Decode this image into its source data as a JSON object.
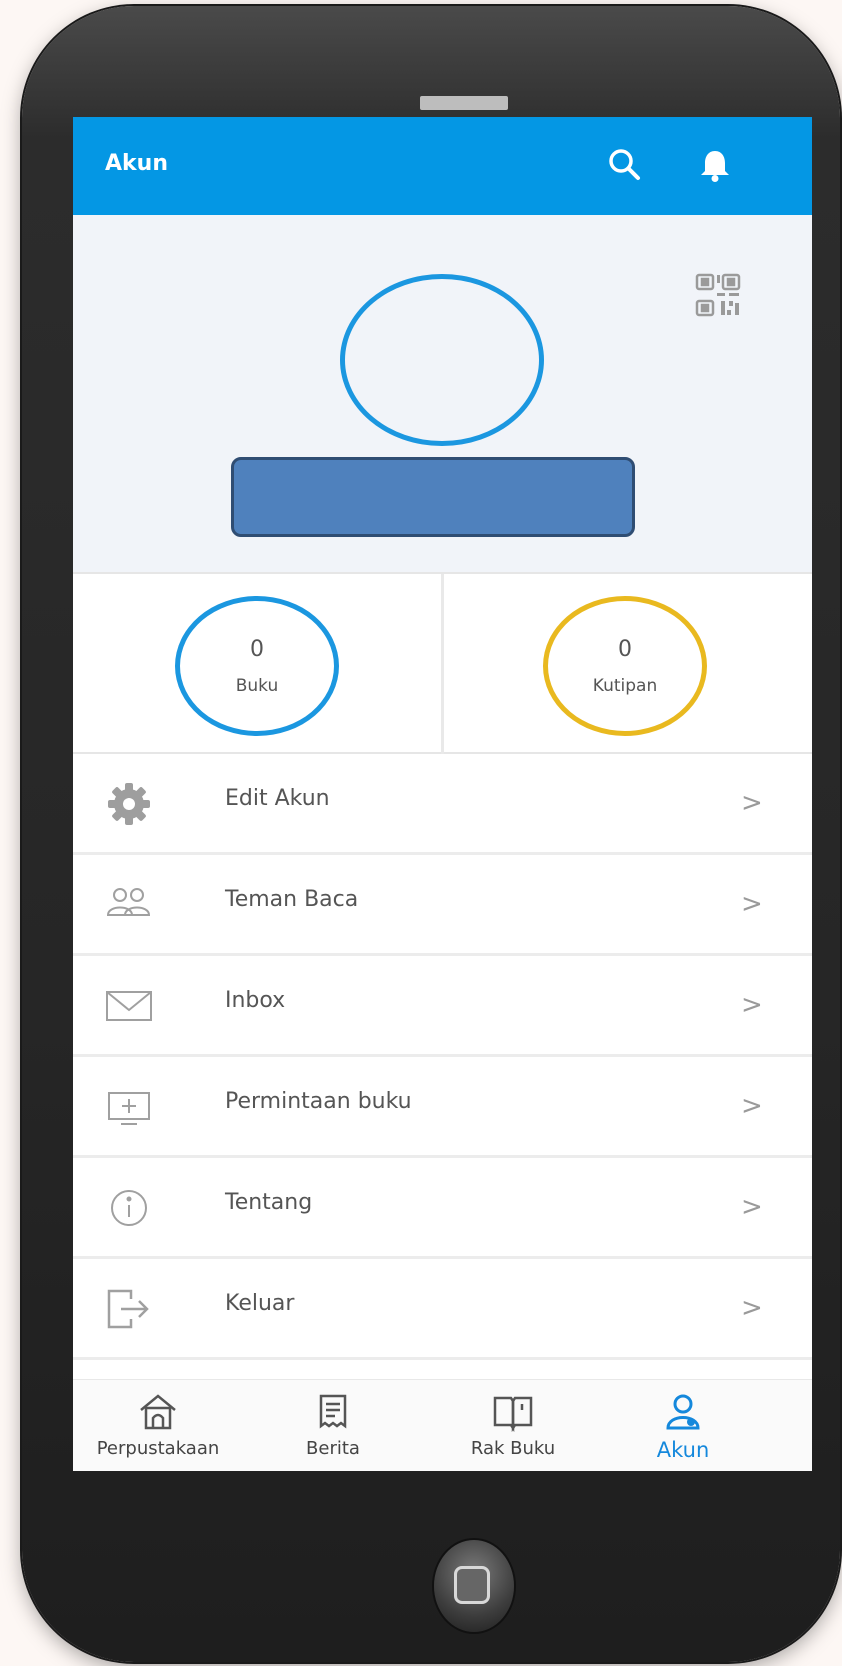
{
  "appbar": {
    "title": "Akun",
    "icons": [
      "search-icon",
      "bell-icon"
    ],
    "color": "#0497e4"
  },
  "profile": {
    "qr_icon": "qr-code-icon"
  },
  "stats": [
    {
      "value": "0",
      "label": "Buku",
      "color": "#1b97e0"
    },
    {
      "value": "0",
      "label": "Kutipan",
      "color": "#e9b91f"
    }
  ],
  "menu": [
    {
      "label": "Edit Akun",
      "icon": "gear-icon"
    },
    {
      "label": "Teman Baca",
      "icon": "friends-icon"
    },
    {
      "label": "Inbox",
      "icon": "envelope-icon"
    },
    {
      "label": "Permintaan buku",
      "icon": "monitor-plus-icon"
    },
    {
      "label": "Tentang",
      "icon": "info-icon"
    },
    {
      "label": "Keluar",
      "icon": "logout-icon"
    }
  ],
  "chevron": ">",
  "bottom_nav": [
    {
      "label": "Perpustakaan",
      "icon": "home-icon",
      "active": false
    },
    {
      "label": "Berita",
      "icon": "news-icon",
      "active": false
    },
    {
      "label": "Rak Buku",
      "icon": "open-book-icon",
      "active": false
    },
    {
      "label": "Akun",
      "icon": "user-icon",
      "active": true
    }
  ],
  "active_color": "#1488dc"
}
